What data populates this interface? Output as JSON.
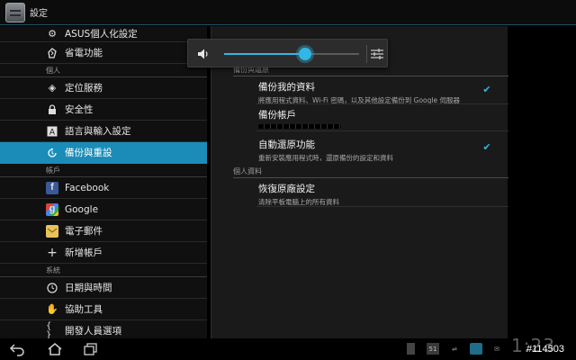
{
  "topbar": {
    "title": "設定"
  },
  "sidebar": {
    "items": [
      {
        "label": "ASUS個人化設定",
        "icon": "gear-icon"
      },
      {
        "label": "省電功能",
        "icon": "power-saving-icon"
      }
    ],
    "sections": [
      {
        "header": "個人",
        "items": [
          {
            "label": "定位服務",
            "icon": "location-icon"
          },
          {
            "label": "安全性",
            "icon": "lock-icon"
          },
          {
            "label": "語言與輸入設定",
            "icon": "keyboard-icon"
          },
          {
            "label": "備份與重設",
            "icon": "backup-icon",
            "active": true
          }
        ]
      },
      {
        "header": "帳戶",
        "items": [
          {
            "label": "Facebook",
            "icon": "facebook-icon"
          },
          {
            "label": "Google",
            "icon": "google-icon"
          },
          {
            "label": "電子郵件",
            "icon": "email-icon"
          },
          {
            "label": "新增帳戶",
            "icon": "plus-icon"
          }
        ]
      },
      {
        "header": "系統",
        "items": [
          {
            "label": "日期與時間",
            "icon": "clock-icon"
          },
          {
            "label": "協助工具",
            "icon": "hand-icon"
          },
          {
            "label": "開發人員選項",
            "icon": "braces-icon"
          }
        ]
      }
    ]
  },
  "main": {
    "section1_header": "備份與還原",
    "backup_data": {
      "title": "備份我的資料",
      "summary": "將應用程式資料、Wi-Fi 密碼，以及其他設定備份到 Google 伺服器",
      "checked": true
    },
    "backup_account": {
      "title": "備份帳戶"
    },
    "auto_restore": {
      "title": "自動還原功能",
      "summary": "重新安裝應用程式時，還原備份的設定和資料",
      "checked": true
    },
    "section2_header": "個人資料",
    "factory_reset": {
      "title": "恢復原廠設定",
      "summary": "清除平板電腦上的所有資料"
    }
  },
  "volume": {
    "level": 0.6
  },
  "systembar": {
    "status_text": "51",
    "clock": "1:23",
    "watermark": "#114503"
  },
  "colors": {
    "accent": "#33b5e5",
    "selected": "#1b8cb7"
  }
}
